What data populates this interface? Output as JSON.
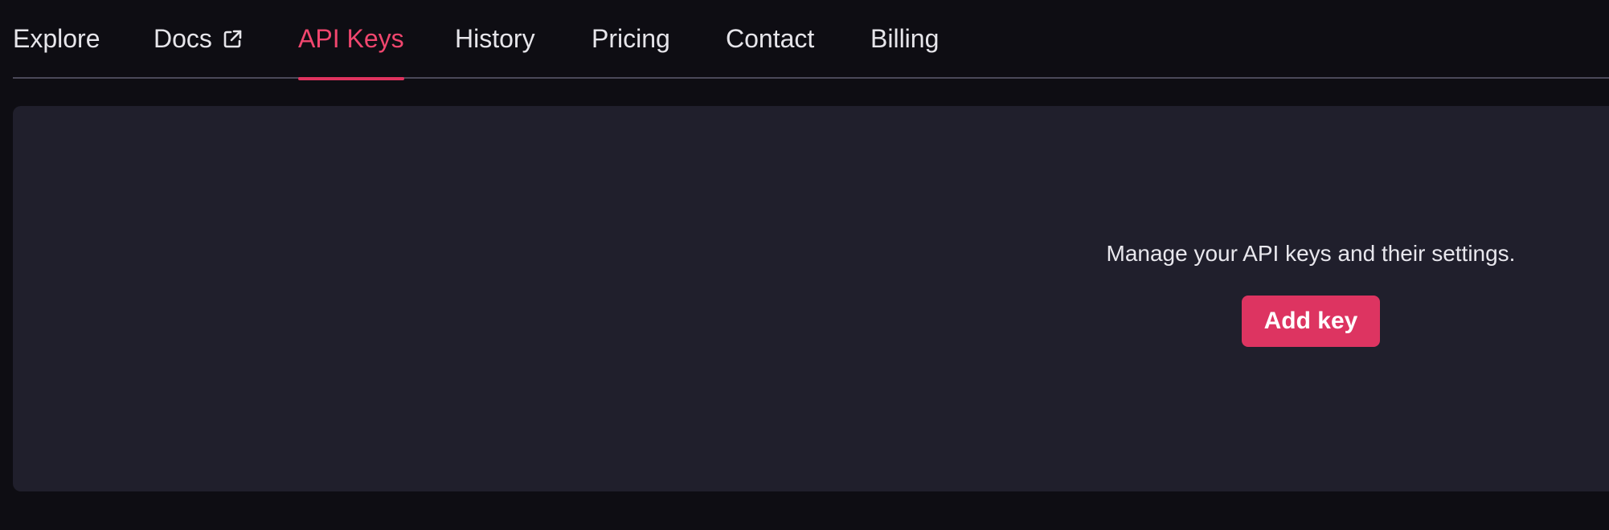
{
  "nav": {
    "tabs": [
      {
        "label": "Explore",
        "active": false
      },
      {
        "label": "Docs",
        "active": false,
        "icon": "external-link-icon"
      },
      {
        "label": "API Keys",
        "active": true
      },
      {
        "label": "History",
        "active": false
      },
      {
        "label": "Pricing",
        "active": false
      },
      {
        "label": "Contact",
        "active": false
      },
      {
        "label": "Billing",
        "active": false
      }
    ]
  },
  "main": {
    "description": "Manage your API keys and their settings.",
    "add_button_label": "Add key"
  },
  "colors": {
    "background": "#0e0d13",
    "card": "#201f2c",
    "accent": "#dd3461",
    "active_tab_text": "#f0466e",
    "text": "#e6e5ea"
  }
}
